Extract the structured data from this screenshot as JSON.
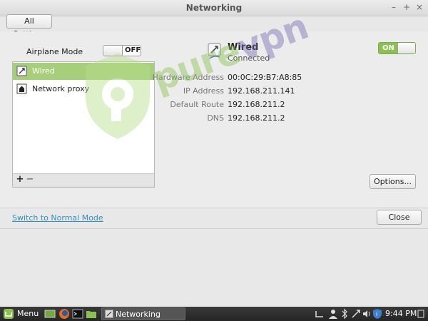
{
  "window": {
    "title": "Networking"
  },
  "toolbar": {
    "all_settings": "All Settings"
  },
  "airplane": {
    "label": "Airplane Mode",
    "state": "OFF"
  },
  "connections": [
    {
      "label": "Wired",
      "icon": "wired-network-icon",
      "selected": true
    },
    {
      "label": "Network proxy",
      "icon": "proxy-icon",
      "selected": false
    }
  ],
  "list_controls": {
    "add": "+",
    "remove": "−"
  },
  "wired": {
    "name": "Wired",
    "status": "Connected",
    "switch_state": "ON",
    "details": [
      {
        "key": "Hardware Address",
        "value": "00:0C:29:B7:A8:85"
      },
      {
        "key": "IP Address",
        "value": "192.168.211.141"
      },
      {
        "key": "Default Route",
        "value": "192.168.211.2"
      },
      {
        "key": "DNS",
        "value": "192.168.211.2"
      }
    ],
    "options_button": "Options..."
  },
  "footer": {
    "switch_mode": "Switch to Normal Mode",
    "close": "Close"
  },
  "watermark": {
    "text": "purevpn"
  },
  "taskbar": {
    "menu_label": "Menu",
    "task_title": "Networking",
    "clock": "9:44 PM"
  },
  "colors": {
    "accent_green": "#8cc152",
    "selected_row": "#a7cf7a",
    "link": "#2f8fbf"
  }
}
